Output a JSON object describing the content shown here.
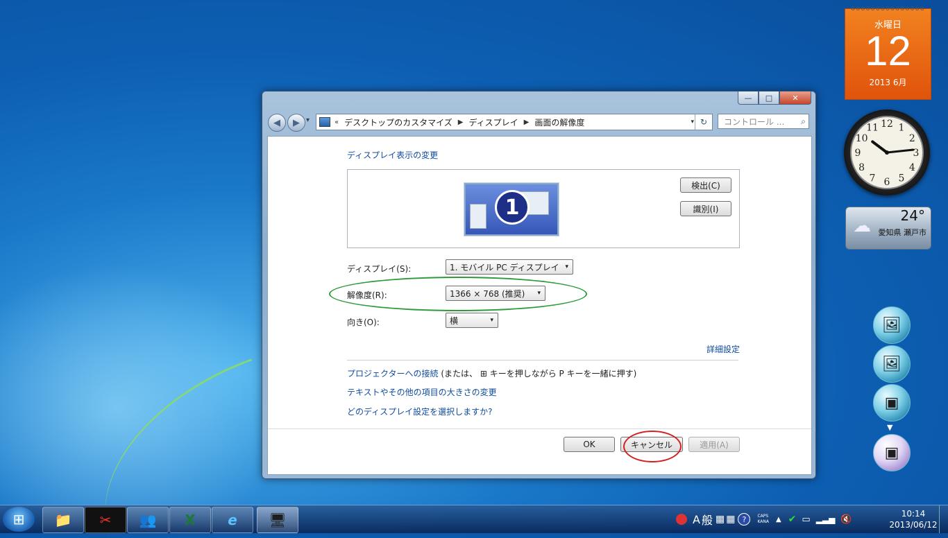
{
  "window": {
    "caption_minimize": "—",
    "caption_maximize": "□",
    "caption_close": "✕",
    "nav_back": "◀",
    "nav_forward": "▶",
    "nav_recent": "▾",
    "address": {
      "prefix": "«",
      "crumbs": [
        "デスクトップのカスタマイズ",
        "ディスプレイ",
        "画面の解像度"
      ],
      "separator": "▶",
      "dropdown": "▾",
      "refresh": "↻"
    },
    "search": {
      "placeholder": "コントロール ...",
      "icon": "⌕"
    }
  },
  "content": {
    "heading": "ディスプレイ表示の変更",
    "monitor_number": "1",
    "detect_button": "検出(C)",
    "identify_button": "識別(I)",
    "display_label": "ディスプレイ(S):",
    "display_value": "1. モバイル PC ディスプレイ",
    "resolution_label": "解像度(R):",
    "resolution_value": "1366 × 768 (推奨)",
    "orientation_label": "向き(O):",
    "orientation_value": "横",
    "combo_caret": "▾",
    "advanced_link": "詳細設定",
    "projector_link": "プロジェクターへの接続",
    "projector_note": " (または、",
    "projector_note2": " キーを押しながら P キーを一緒に押す)",
    "win_key_icon": "⊞",
    "text_size_link": "テキストやその他の項目の大きさの変更",
    "which_display_link": "どのディスプレイ設定を選択しますか?",
    "ok_button": "OK",
    "cancel_button": "キャンセル",
    "apply_button": "適用(A)"
  },
  "gadgets": {
    "calendar": {
      "weekday": "水曜日",
      "day": "12",
      "year_month": "2013 6月"
    },
    "clock": {
      "numerals": [
        "12",
        "1",
        "2",
        "3",
        "4",
        "5",
        "6",
        "7",
        "8",
        "9",
        "10",
        "11"
      ],
      "hour": 10,
      "minute": 14
    },
    "weather": {
      "temperature": "24°",
      "city": "愛知県 瀬戸市"
    }
  },
  "taskbar": {
    "start_icon": "⊞",
    "pinned": [
      {
        "name": "explorer",
        "glyph": "📁"
      },
      {
        "name": "tools",
        "glyph": "✂"
      },
      {
        "name": "messenger",
        "glyph": "👥"
      },
      {
        "name": "excel",
        "glyph": "X"
      },
      {
        "name": "ie",
        "glyph": "e"
      },
      {
        "name": "control-panel",
        "glyph": "🖥"
      }
    ],
    "ime_mode": "A",
    "ime_kanji": "般",
    "caps": "CAPS",
    "kana": "KANA",
    "help": "?",
    "tray_arrow": "▲",
    "time": "10:14",
    "date": "2013/06/12"
  },
  "colors": {
    "accent": "#0e4a9e",
    "calendar": "#e8661a",
    "green_mark": "#2e9b3a",
    "red_mark": "#d22020"
  }
}
